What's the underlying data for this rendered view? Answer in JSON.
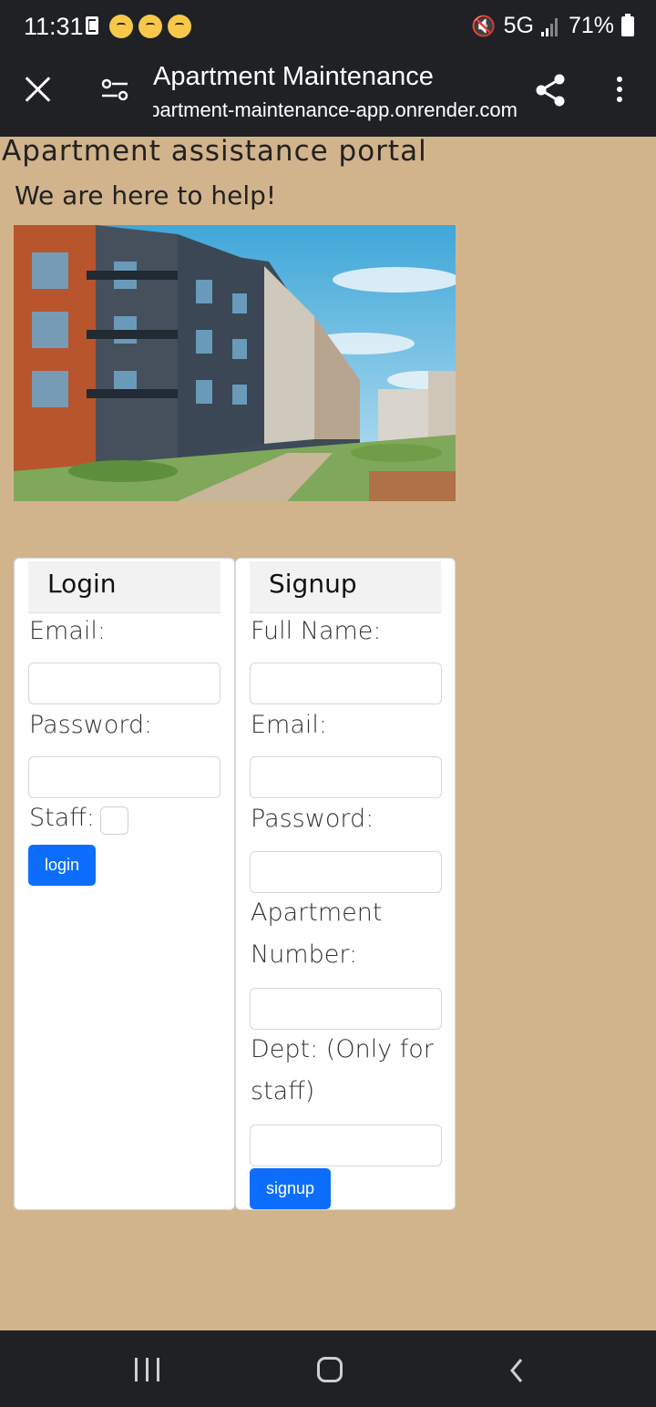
{
  "status_bar": {
    "time": "11:31",
    "network": "5G",
    "battery": "71%"
  },
  "browser": {
    "title": "Apartment Maintenance",
    "url": "apartment-maintenance-app.onrender.com"
  },
  "page": {
    "title": "Apartment assistance portal",
    "tagline": "We are here to help!"
  },
  "login": {
    "header": "Login",
    "email_label": "Email:",
    "email_value": "",
    "password_label": "Password:",
    "password_value": "",
    "staff_label": "Staff:",
    "staff_checked": false,
    "submit_label": "login"
  },
  "signup": {
    "header": "Signup",
    "fullname_label": "Full Name:",
    "email_label": "Email:",
    "password_label": "Password:",
    "apartment_label_line1": "Apartment",
    "apartment_label_line2": "Number:",
    "dept_label_line1": "Dept: (Only for",
    "dept_label_line2": "staff)",
    "submit_label": "signup"
  },
  "colors": {
    "page_background": "#D2B48C",
    "primary_button": "#0d6efd",
    "system_bar": "#1f2124"
  },
  "icons": [
    "close-icon",
    "tune-icon",
    "share-icon",
    "more-vert-icon",
    "mute-icon",
    "signal-icon",
    "battery-icon",
    "sim-icon",
    "recent-apps-icon",
    "home-icon",
    "back-icon"
  ]
}
